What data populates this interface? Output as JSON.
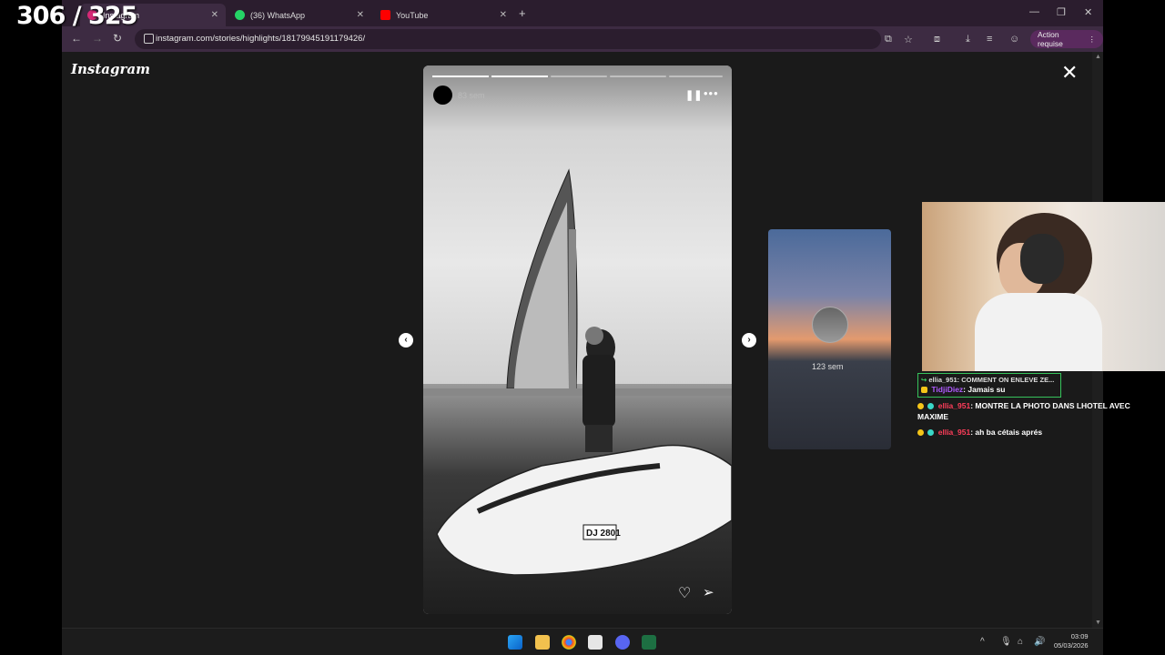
{
  "overlay": {
    "counter": "306 / 325"
  },
  "browser": {
    "tabs": [
      {
        "title": "Instagram",
        "icon": "instagram-icon",
        "active": true
      },
      {
        "title": "(36) WhatsApp",
        "icon": "whatsapp-icon",
        "active": false
      },
      {
        "title": "YouTube",
        "icon": "youtube-icon",
        "active": false
      }
    ],
    "url": "instagram.com/stories/highlights/18179945191179426/",
    "action_button": "Action requise"
  },
  "instagram": {
    "logo": "Instagram",
    "story": {
      "time": "83 sem",
      "progress_segments": [
        1,
        0.5,
        0,
        0,
        0
      ]
    },
    "next_story": {
      "time": "123 sem"
    }
  },
  "chat": {
    "reply": {
      "user": "ellia_951",
      "text": "COMMENT ON ENLEVE ZE..."
    },
    "messages": [
      {
        "user": "TidjiDiez",
        "text": "Jamais su",
        "color": "#b05bff"
      },
      {
        "user": "ellia_951",
        "text": "MONTRE LA PHOTO DANS LHOTEL AVEC MAXIME",
        "color": "#ff3d5a"
      },
      {
        "user": "ellia_951",
        "text": "ah ba cétais aprés",
        "color": "#ff3d5a"
      }
    ]
  },
  "taskbar": {
    "time": "03:09",
    "date": "05/03/2026"
  }
}
